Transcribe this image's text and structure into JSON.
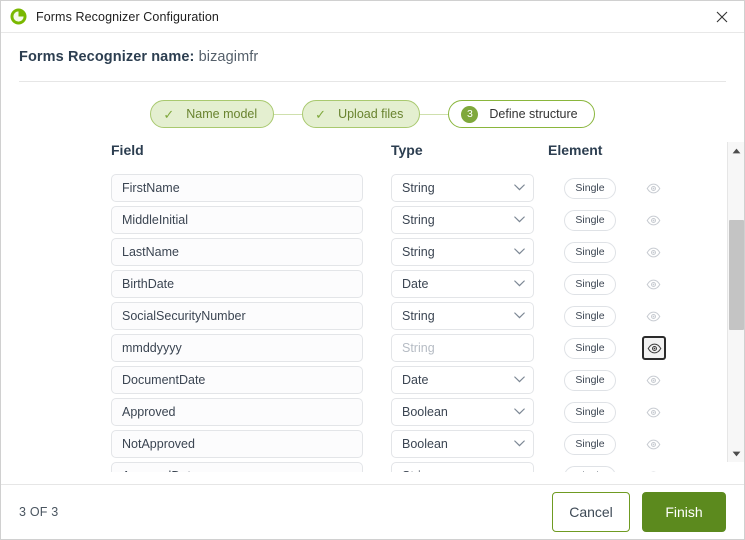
{
  "window": {
    "title": "Forms Recognizer Configuration",
    "logo_icon": "bizagi-green-circle-icon",
    "close_icon": "close-icon"
  },
  "header": {
    "name_label": "Forms Recognizer name:",
    "name_value": "bizagimfr"
  },
  "stepper": {
    "steps": [
      {
        "label": "Name model",
        "state": "done",
        "marker": "✓"
      },
      {
        "label": "Upload files",
        "state": "done",
        "marker": "✓"
      },
      {
        "label": "Define structure",
        "state": "current",
        "marker": "3"
      }
    ]
  },
  "table": {
    "columns": [
      "Field",
      "Type",
      "Element"
    ],
    "rows": [
      {
        "field": "FirstName",
        "type": "String",
        "type_disabled": false,
        "element": "Single",
        "eye_focused": false
      },
      {
        "field": "MiddleInitial",
        "type": "String",
        "type_disabled": false,
        "element": "Single",
        "eye_focused": false
      },
      {
        "field": "LastName",
        "type": "String",
        "type_disabled": false,
        "element": "Single",
        "eye_focused": false
      },
      {
        "field": "BirthDate",
        "type": "Date",
        "type_disabled": false,
        "element": "Single",
        "eye_focused": false
      },
      {
        "field": "SocialSecurityNumber",
        "type": "String",
        "type_disabled": false,
        "element": "Single",
        "eye_focused": false
      },
      {
        "field": "mmddyyyy",
        "type": "String",
        "type_disabled": true,
        "element": "Single",
        "eye_focused": true
      },
      {
        "field": "DocumentDate",
        "type": "Date",
        "type_disabled": false,
        "element": "Single",
        "eye_focused": false
      },
      {
        "field": "Approved",
        "type": "Boolean",
        "type_disabled": false,
        "element": "Single",
        "eye_focused": false
      },
      {
        "field": "NotApproved",
        "type": "Boolean",
        "type_disabled": false,
        "element": "Single",
        "eye_focused": false
      },
      {
        "field": "ApprovalDate",
        "type": "String",
        "type_disabled": false,
        "element": "Single",
        "eye_focused": false
      }
    ],
    "chevron_icon": "chevron-down-icon",
    "eye_icon": "eye-icon",
    "scrollbar": {
      "up_icon": "scroll-up-arrow-icon",
      "down_icon": "scroll-down-arrow-icon"
    }
  },
  "footer": {
    "page_count": "3 OF 3",
    "cancel_label": "Cancel",
    "finish_label": "Finish"
  },
  "colors": {
    "brand_green": "#5c8a1e",
    "step_green": "#7fa83c",
    "step_done_bg": "#e4efd0"
  }
}
